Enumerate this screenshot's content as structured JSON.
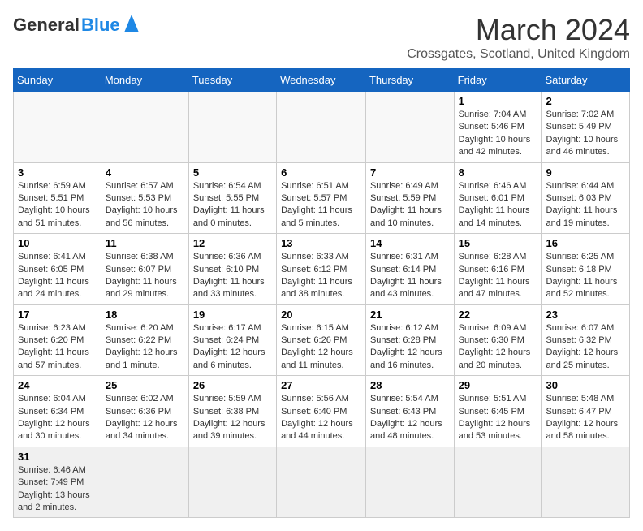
{
  "header": {
    "logo_general": "General",
    "logo_blue": "Blue",
    "title": "March 2024",
    "subtitle": "Crossgates, Scotland, United Kingdom"
  },
  "weekdays": [
    "Sunday",
    "Monday",
    "Tuesday",
    "Wednesday",
    "Thursday",
    "Friday",
    "Saturday"
  ],
  "weeks": [
    [
      {
        "day": "",
        "info": ""
      },
      {
        "day": "",
        "info": ""
      },
      {
        "day": "",
        "info": ""
      },
      {
        "day": "",
        "info": ""
      },
      {
        "day": "",
        "info": ""
      },
      {
        "day": "1",
        "info": "Sunrise: 7:04 AM\nSunset: 5:46 PM\nDaylight: 10 hours and 42 minutes."
      },
      {
        "day": "2",
        "info": "Sunrise: 7:02 AM\nSunset: 5:49 PM\nDaylight: 10 hours and 46 minutes."
      }
    ],
    [
      {
        "day": "3",
        "info": "Sunrise: 6:59 AM\nSunset: 5:51 PM\nDaylight: 10 hours and 51 minutes."
      },
      {
        "day": "4",
        "info": "Sunrise: 6:57 AM\nSunset: 5:53 PM\nDaylight: 10 hours and 56 minutes."
      },
      {
        "day": "5",
        "info": "Sunrise: 6:54 AM\nSunset: 5:55 PM\nDaylight: 11 hours and 0 minutes."
      },
      {
        "day": "6",
        "info": "Sunrise: 6:51 AM\nSunset: 5:57 PM\nDaylight: 11 hours and 5 minutes."
      },
      {
        "day": "7",
        "info": "Sunrise: 6:49 AM\nSunset: 5:59 PM\nDaylight: 11 hours and 10 minutes."
      },
      {
        "day": "8",
        "info": "Sunrise: 6:46 AM\nSunset: 6:01 PM\nDaylight: 11 hours and 14 minutes."
      },
      {
        "day": "9",
        "info": "Sunrise: 6:44 AM\nSunset: 6:03 PM\nDaylight: 11 hours and 19 minutes."
      }
    ],
    [
      {
        "day": "10",
        "info": "Sunrise: 6:41 AM\nSunset: 6:05 PM\nDaylight: 11 hours and 24 minutes."
      },
      {
        "day": "11",
        "info": "Sunrise: 6:38 AM\nSunset: 6:07 PM\nDaylight: 11 hours and 29 minutes."
      },
      {
        "day": "12",
        "info": "Sunrise: 6:36 AM\nSunset: 6:10 PM\nDaylight: 11 hours and 33 minutes."
      },
      {
        "day": "13",
        "info": "Sunrise: 6:33 AM\nSunset: 6:12 PM\nDaylight: 11 hours and 38 minutes."
      },
      {
        "day": "14",
        "info": "Sunrise: 6:31 AM\nSunset: 6:14 PM\nDaylight: 11 hours and 43 minutes."
      },
      {
        "day": "15",
        "info": "Sunrise: 6:28 AM\nSunset: 6:16 PM\nDaylight: 11 hours and 47 minutes."
      },
      {
        "day": "16",
        "info": "Sunrise: 6:25 AM\nSunset: 6:18 PM\nDaylight: 11 hours and 52 minutes."
      }
    ],
    [
      {
        "day": "17",
        "info": "Sunrise: 6:23 AM\nSunset: 6:20 PM\nDaylight: 11 hours and 57 minutes."
      },
      {
        "day": "18",
        "info": "Sunrise: 6:20 AM\nSunset: 6:22 PM\nDaylight: 12 hours and 1 minute."
      },
      {
        "day": "19",
        "info": "Sunrise: 6:17 AM\nSunset: 6:24 PM\nDaylight: 12 hours and 6 minutes."
      },
      {
        "day": "20",
        "info": "Sunrise: 6:15 AM\nSunset: 6:26 PM\nDaylight: 12 hours and 11 minutes."
      },
      {
        "day": "21",
        "info": "Sunrise: 6:12 AM\nSunset: 6:28 PM\nDaylight: 12 hours and 16 minutes."
      },
      {
        "day": "22",
        "info": "Sunrise: 6:09 AM\nSunset: 6:30 PM\nDaylight: 12 hours and 20 minutes."
      },
      {
        "day": "23",
        "info": "Sunrise: 6:07 AM\nSunset: 6:32 PM\nDaylight: 12 hours and 25 minutes."
      }
    ],
    [
      {
        "day": "24",
        "info": "Sunrise: 6:04 AM\nSunset: 6:34 PM\nDaylight: 12 hours and 30 minutes."
      },
      {
        "day": "25",
        "info": "Sunrise: 6:02 AM\nSunset: 6:36 PM\nDaylight: 12 hours and 34 minutes."
      },
      {
        "day": "26",
        "info": "Sunrise: 5:59 AM\nSunset: 6:38 PM\nDaylight: 12 hours and 39 minutes."
      },
      {
        "day": "27",
        "info": "Sunrise: 5:56 AM\nSunset: 6:40 PM\nDaylight: 12 hours and 44 minutes."
      },
      {
        "day": "28",
        "info": "Sunrise: 5:54 AM\nSunset: 6:43 PM\nDaylight: 12 hours and 48 minutes."
      },
      {
        "day": "29",
        "info": "Sunrise: 5:51 AM\nSunset: 6:45 PM\nDaylight: 12 hours and 53 minutes."
      },
      {
        "day": "30",
        "info": "Sunrise: 5:48 AM\nSunset: 6:47 PM\nDaylight: 12 hours and 58 minutes."
      }
    ],
    [
      {
        "day": "31",
        "info": "Sunrise: 6:46 AM\nSunset: 7:49 PM\nDaylight: 13 hours and 2 minutes."
      },
      {
        "day": "",
        "info": ""
      },
      {
        "day": "",
        "info": ""
      },
      {
        "day": "",
        "info": ""
      },
      {
        "day": "",
        "info": ""
      },
      {
        "day": "",
        "info": ""
      },
      {
        "day": "",
        "info": ""
      }
    ]
  ]
}
